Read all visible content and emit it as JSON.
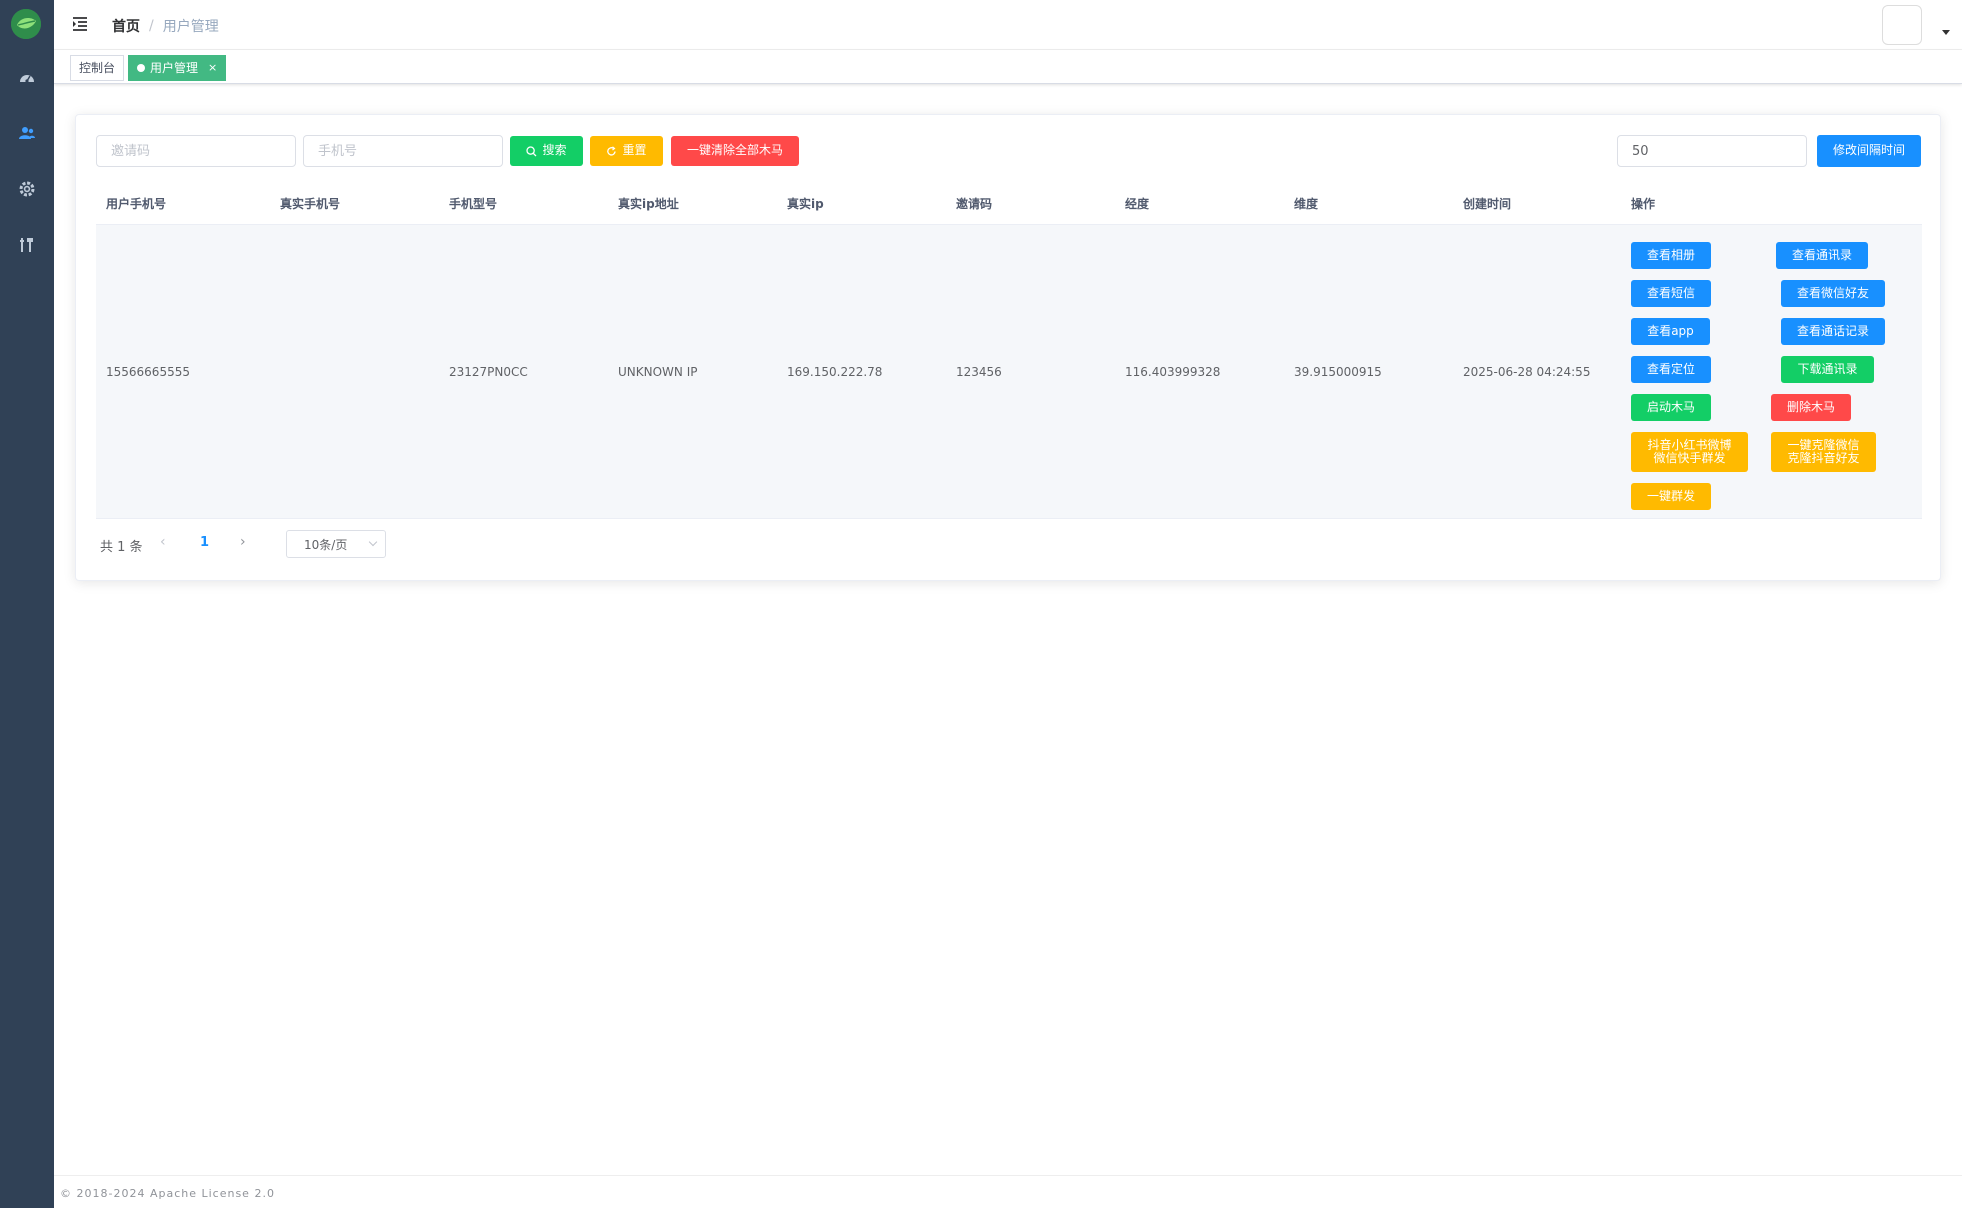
{
  "navbar": {
    "breadcrumb_home": "首页",
    "breadcrumb_sep": "/",
    "breadcrumb_current": "用户管理"
  },
  "tags": {
    "console": "控制台",
    "user_mgmt": "用户管理",
    "close": "×"
  },
  "search": {
    "invite_placeholder": "邀请码",
    "phone_placeholder": "手机号",
    "search_label": "搜索",
    "reset_label": "重置",
    "clear_all_label": "一键清除全部木马",
    "interval_value": "50",
    "modify_interval_label": "修改间隔时间"
  },
  "table": {
    "columns": [
      "用户手机号",
      "真实手机号",
      "手机型号",
      "真实ip地址",
      "真实ip",
      "邀请码",
      "经度",
      "维度",
      "创建时间",
      "操作"
    ],
    "row": {
      "user_phone": "15566665555",
      "real_phone": "",
      "model": "23127PN0CC",
      "real_ip_addr": "UNKNOWN IP",
      "real_ip": "169.150.222.78",
      "invite_code": "123456",
      "longitude": "116.403999328",
      "latitude": "39.915000915",
      "created": "2025-06-28 04:24:55"
    },
    "actions": {
      "view_album": "查看相册",
      "view_contacts": "查看通讯录",
      "view_sms": "查看短信",
      "view_wechat_friends": "查看微信好友",
      "view_app": "查看app",
      "view_call_log": "查看通话记录",
      "view_location": "查看定位",
      "download_contacts": "下载通讯录",
      "start_trojan": "启动木马",
      "delete_trojan": "删除木马",
      "mass_send_line1": "抖音小红书微博",
      "mass_send_line2": "微信快手群发",
      "clone_line1": "一键克隆微信",
      "clone_line2": "克隆抖音好友",
      "one_click_send": "一键群发"
    }
  },
  "pagination": {
    "total": "共 1 条",
    "current": "1",
    "page_size": "10条/页"
  },
  "footer": {
    "text": "© 2018-2024 Apache License 2.0"
  },
  "colors": {
    "sidebar": "#304156",
    "green": "#13ce66",
    "orange": "#ffba00",
    "red": "#ff4949",
    "blue": "#1890ff",
    "tag_active": "#42b983"
  },
  "icons": [
    "logo-icon",
    "dashboard-icon",
    "users-icon",
    "settings-icon",
    "tools-icon",
    "hamburger-icon",
    "search-icon",
    "refresh-icon"
  ]
}
